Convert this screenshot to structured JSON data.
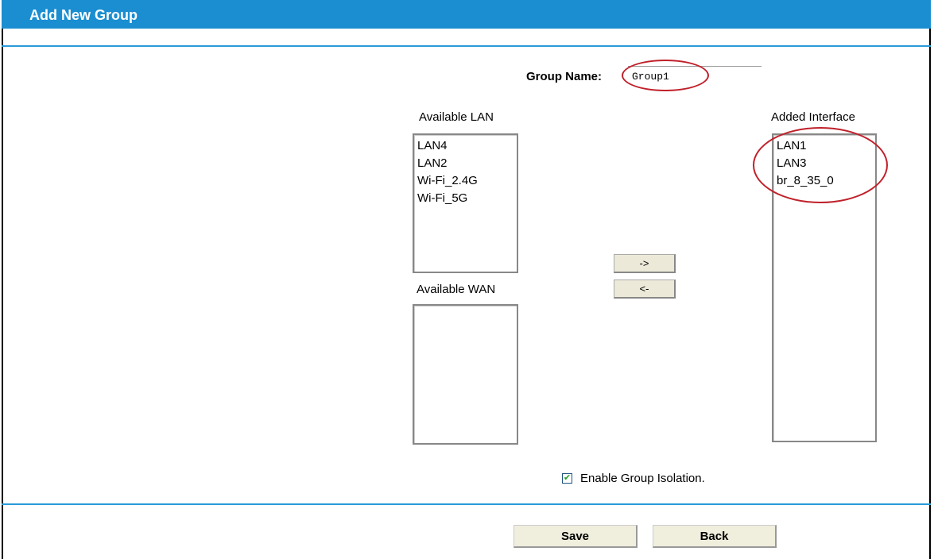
{
  "header": {
    "title": "Add New Group"
  },
  "form": {
    "group_name_label": "Group Name:",
    "group_name_value": "Group1",
    "available_lan_label": "Available LAN",
    "available_lan_items": [
      "LAN4",
      "LAN2",
      "Wi-Fi_2.4G",
      "Wi-Fi_5G"
    ],
    "available_wan_label": "Available WAN",
    "added_interface_label": "Added Interface",
    "added_interface_items": [
      "LAN1",
      "LAN3",
      "br_8_35_0"
    ],
    "move_right_label": "->",
    "move_left_label": "<-",
    "isolation_label": "Enable Group Isolation.",
    "isolation_checked": true
  },
  "actions": {
    "save_label": "Save",
    "back_label": "Back"
  },
  "colors": {
    "header": "#1a8ed1",
    "annotation": "#c0202a"
  }
}
